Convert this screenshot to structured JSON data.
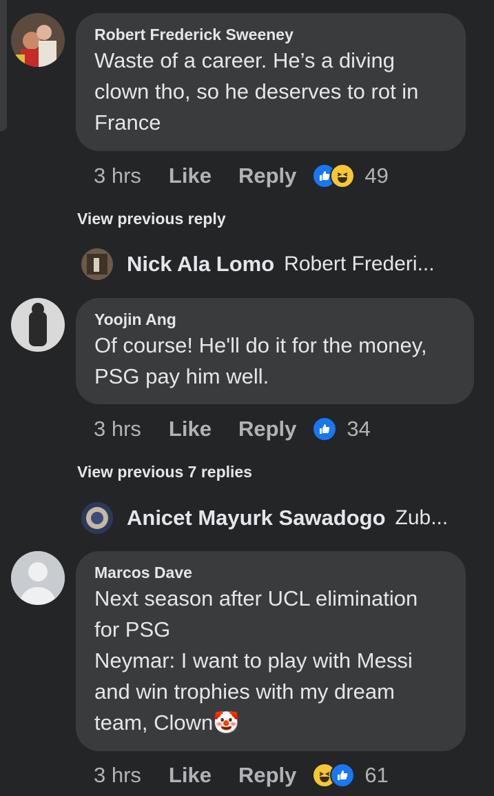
{
  "comments": [
    {
      "author": "Robert Frederick Sweeney",
      "text": "Waste of a career. He’s a diving clown tho, so he deserves to rot in France",
      "time": "3 hrs",
      "like_label": "Like",
      "reply_label": "Reply",
      "reactions": [
        "like",
        "haha"
      ],
      "reaction_count": "49"
    },
    {
      "author": "Yoojin Ang",
      "text": "Of course! He'll do it for the money, PSG pay him well.",
      "time": "3 hrs",
      "like_label": "Like",
      "reply_label": "Reply",
      "reactions": [
        "like"
      ],
      "reaction_count": "34"
    },
    {
      "author": "Marcos Dave",
      "text": "Next season after UCL elimination for PSG\nNeymar: I want to play with Messi and win trophies with my dream team, Clown",
      "emoji": "🤡",
      "time": "3 hrs",
      "like_label": "Like",
      "reply_label": "Reply",
      "reactions": [
        "haha",
        "like"
      ],
      "reaction_count": "61"
    }
  ],
  "threads": [
    {
      "view_label": "View previous reply",
      "reply_author": "Nick Ala Lomo",
      "reply_snippet": "Robert Frederi..."
    },
    {
      "view_label": "View previous 7 replies",
      "reply_author": "Anicet Mayurk Sawadogo",
      "reply_snippet": "Zub..."
    }
  ],
  "colors": {
    "background": "#242526",
    "bubble": "#3a3b3c",
    "muted": "#b0b3b8",
    "like_blue": "#1877f2",
    "haha_yellow": "#f7c634"
  }
}
